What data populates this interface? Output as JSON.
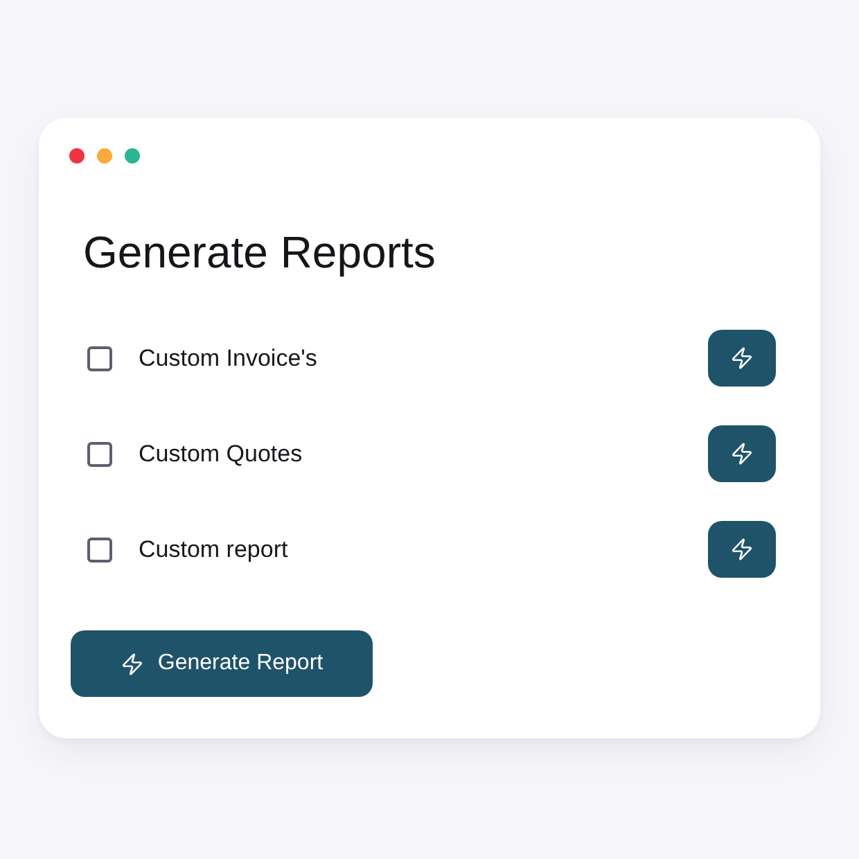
{
  "window": {
    "dots": [
      {
        "color": "#ef3340"
      },
      {
        "color": "#fbab3a"
      },
      {
        "color": "#2bb594"
      }
    ]
  },
  "title": "Generate Reports",
  "reports": [
    {
      "label": "Custom Invoice's",
      "checked": false
    },
    {
      "label": "Custom Quotes",
      "checked": false
    },
    {
      "label": "Custom report",
      "checked": false
    }
  ],
  "generate_button": {
    "label": "Generate Report"
  }
}
